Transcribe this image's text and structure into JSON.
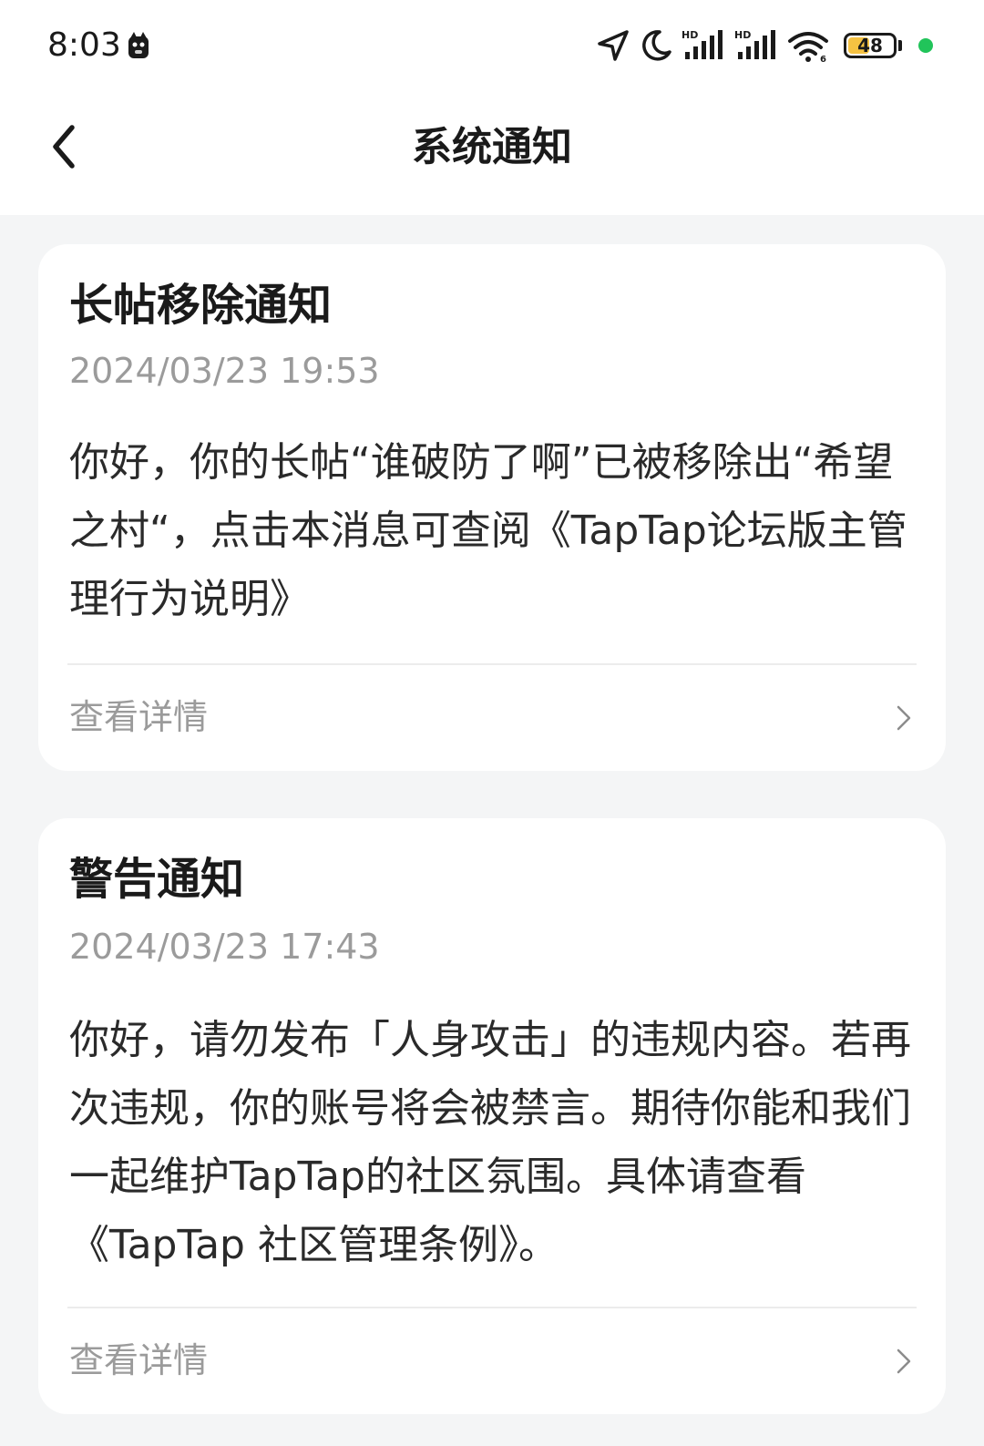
{
  "status_bar": {
    "time": "8:03",
    "battery_level": "48",
    "battery_fraction": 0.48,
    "icons": [
      "location-icon",
      "moon-icon",
      "hd-signal-icon",
      "hd-signal-icon",
      "wifi-icon",
      "battery-icon"
    ],
    "colors": {
      "battery_fill": "#f5c242",
      "dot": "#21c45a"
    }
  },
  "nav": {
    "title": "系统通知",
    "back_icon": "chevron-left-icon"
  },
  "notifications": [
    {
      "title": "长帖移除通知",
      "date": "2024/03/23 19:53",
      "body": "你好，你的长帖“谁破防了啊”已被移除出“希望之村“，点击本消息可查阅《TapTap论坛版主管理行为说明》",
      "details_label": "查看详情"
    },
    {
      "title": "警告通知",
      "date": "2024/03/23 17:43",
      "body": "你好，请勿发布「人身攻击」的违规内容。若再次违规，你的账号将会被禁言。期待你能和我们一起维护TapTap的社区氛围。具体请查看《TapTap 社区管理条例》。",
      "details_label": "查看详情"
    }
  ]
}
